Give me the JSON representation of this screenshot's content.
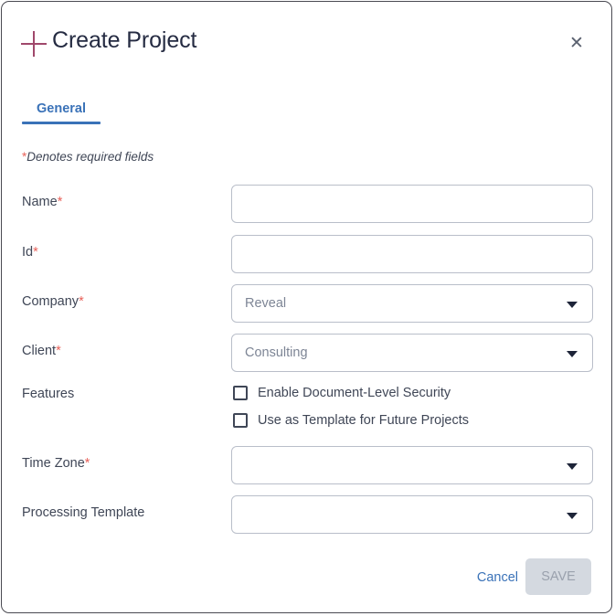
{
  "dialog": {
    "title": "Create Project",
    "add_icon": "plus-icon",
    "close_icon": "close-icon",
    "close_glyph": "✕",
    "accent_plus_color": "#a0486b",
    "accent_tab_color": "#3a72b8",
    "required_star_color": "#e8625a"
  },
  "tabs": [
    {
      "label": "General",
      "active": true
    }
  ],
  "required_note": {
    "star": "*",
    "text": "Denotes required fields"
  },
  "form": {
    "fields": [
      {
        "label": "Name",
        "required": true,
        "type": "text",
        "value": "",
        "placeholder": ""
      },
      {
        "label": "Id",
        "required": true,
        "type": "text",
        "value": "",
        "placeholder": ""
      },
      {
        "label": "Company",
        "required": true,
        "type": "select",
        "value": "Reveal"
      },
      {
        "label": "Client",
        "required": true,
        "type": "select",
        "value": "Consulting"
      },
      {
        "label": "Features",
        "required": false,
        "type": "checkboxes",
        "options": [
          {
            "label": "Enable Document-Level Security",
            "checked": false
          },
          {
            "label": "Use as Template for Future Projects",
            "checked": false
          }
        ]
      },
      {
        "label": "Time Zone",
        "required": true,
        "type": "select",
        "value": ""
      },
      {
        "label": "Processing Template",
        "required": false,
        "type": "select",
        "value": ""
      }
    ]
  },
  "footer": {
    "cancel_label": "Cancel",
    "save_label": "SAVE",
    "save_disabled": true
  }
}
